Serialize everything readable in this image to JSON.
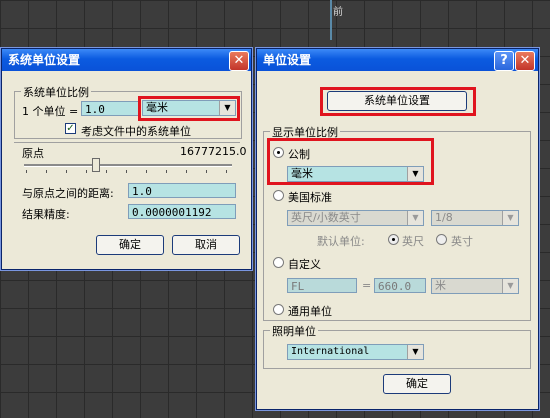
{
  "viewport": {
    "label": "前"
  },
  "left_dialog": {
    "title": "系统单位设置",
    "close_glyph": "✕",
    "group_scale": {
      "title": "系统单位比例",
      "unit_prefix": "1 个单位 =",
      "unit_value": "1.0",
      "unit_select": "毫米",
      "checkbox_label": "考虑文件中的系统单位"
    },
    "origin_label": "原点",
    "origin_value": "16777215.0",
    "distance_label": "与原点之间的距离:",
    "distance_value": "1.0",
    "precision_label": "结果精度:",
    "precision_value": "0.0000001192",
    "ok": "确定",
    "cancel": "取消"
  },
  "right_dialog": {
    "title": "单位设置",
    "help_glyph": "?",
    "close_glyph": "✕",
    "system_unit_button": "系统单位设置",
    "display_group": {
      "title": "显示单位比例",
      "metric_label": "公制",
      "metric_select": "毫米",
      "us_label": "美国标准",
      "us_select": "英尺/小数英寸",
      "fraction_select": "1/8",
      "default_label": "默认单位:",
      "feet_label": "英尺",
      "inch_label": "英寸",
      "custom_label": "自定义",
      "custom_name": "FL",
      "custom_eq": "=",
      "custom_value": "660.0",
      "custom_unit": "米",
      "generic_label": "通用单位"
    },
    "lighting_group": {
      "title": "照明单位",
      "select": "International"
    },
    "ok": "确定"
  },
  "colors": {
    "highlight": "#e0141e",
    "titlebar": "#0a52d8",
    "field": "#b6e3e3"
  },
  "icons": [
    "close-icon",
    "help-icon",
    "dropdown-arrow-icon",
    "checkmark-icon",
    "radio-icon"
  ]
}
